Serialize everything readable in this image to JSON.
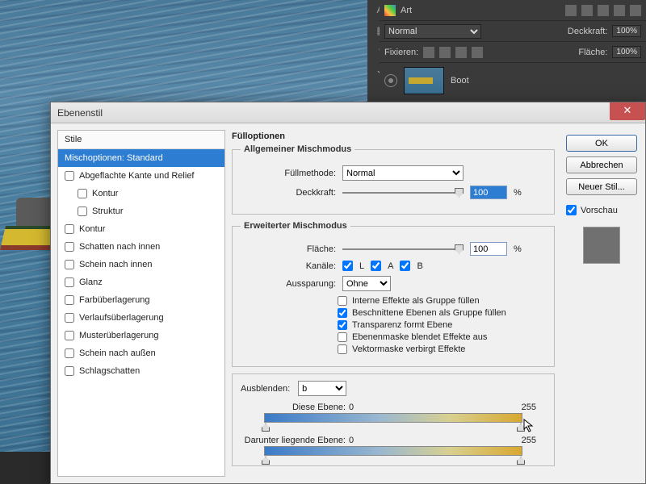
{
  "ps_panel": {
    "preset_label": "Art",
    "blend_mode": "Normal",
    "opacity_label": "Deckkraft:",
    "opacity_value": "100%",
    "lock_label": "Fixieren:",
    "fill_label": "Fläche:",
    "fill_value": "100%",
    "layer_name": "Boot"
  },
  "dialog": {
    "title": "Ebenenstil",
    "styles_header": "Stile",
    "styles": [
      {
        "label": "Mischoptionen: Standard",
        "selected": true,
        "checkbox": false,
        "indent": false
      },
      {
        "label": "Abgeflachte Kante und Relief",
        "selected": false,
        "checkbox": true,
        "indent": false
      },
      {
        "label": "Kontur",
        "selected": false,
        "checkbox": true,
        "indent": true
      },
      {
        "label": "Struktur",
        "selected": false,
        "checkbox": true,
        "indent": true
      },
      {
        "label": "Kontur",
        "selected": false,
        "checkbox": true,
        "indent": false
      },
      {
        "label": "Schatten nach innen",
        "selected": false,
        "checkbox": true,
        "indent": false
      },
      {
        "label": "Schein nach innen",
        "selected": false,
        "checkbox": true,
        "indent": false
      },
      {
        "label": "Glanz",
        "selected": false,
        "checkbox": true,
        "indent": false
      },
      {
        "label": "Farbüberlagerung",
        "selected": false,
        "checkbox": true,
        "indent": false
      },
      {
        "label": "Verlaufsüberlagerung",
        "selected": false,
        "checkbox": true,
        "indent": false
      },
      {
        "label": "Musterüberlagerung",
        "selected": false,
        "checkbox": true,
        "indent": false
      },
      {
        "label": "Schein nach außen",
        "selected": false,
        "checkbox": true,
        "indent": false
      },
      {
        "label": "Schlagschatten",
        "selected": false,
        "checkbox": true,
        "indent": false
      }
    ],
    "section_title": "Fülloptionen",
    "general": {
      "legend": "Allgemeiner Mischmodus",
      "method_label": "Füllmethode:",
      "method_value": "Normal",
      "opacity_label": "Deckkraft:",
      "opacity_value": "100",
      "pct": "%"
    },
    "advanced": {
      "legend": "Erweiterter Mischmodus",
      "fill_label": "Fläche:",
      "fill_value": "100",
      "pct": "%",
      "channels_label": "Kanäle:",
      "ch_l": "L",
      "ch_a": "A",
      "ch_b": "B",
      "knockout_label": "Aussparung:",
      "knockout_value": "Ohne",
      "opts": [
        {
          "label": "Interne Effekte als Gruppe füllen",
          "checked": false
        },
        {
          "label": "Beschnittene Ebenen als Gruppe füllen",
          "checked": true
        },
        {
          "label": "Transparenz formt Ebene",
          "checked": true
        },
        {
          "label": "Ebenenmaske blendet Effekte aus",
          "checked": false
        },
        {
          "label": "Vektormaske verbirgt Effekte",
          "checked": false
        }
      ]
    },
    "blendif": {
      "label": "Ausblenden:",
      "channel": "b",
      "this_label": "Diese Ebene:",
      "this_low": "0",
      "this_high": "255",
      "under_label": "Darunter liegende Ebene:",
      "under_low": "0",
      "under_high": "255"
    },
    "buttons": {
      "ok": "OK",
      "cancel": "Abbrechen",
      "newstyle": "Neuer Stil...",
      "preview": "Vorschau"
    }
  }
}
